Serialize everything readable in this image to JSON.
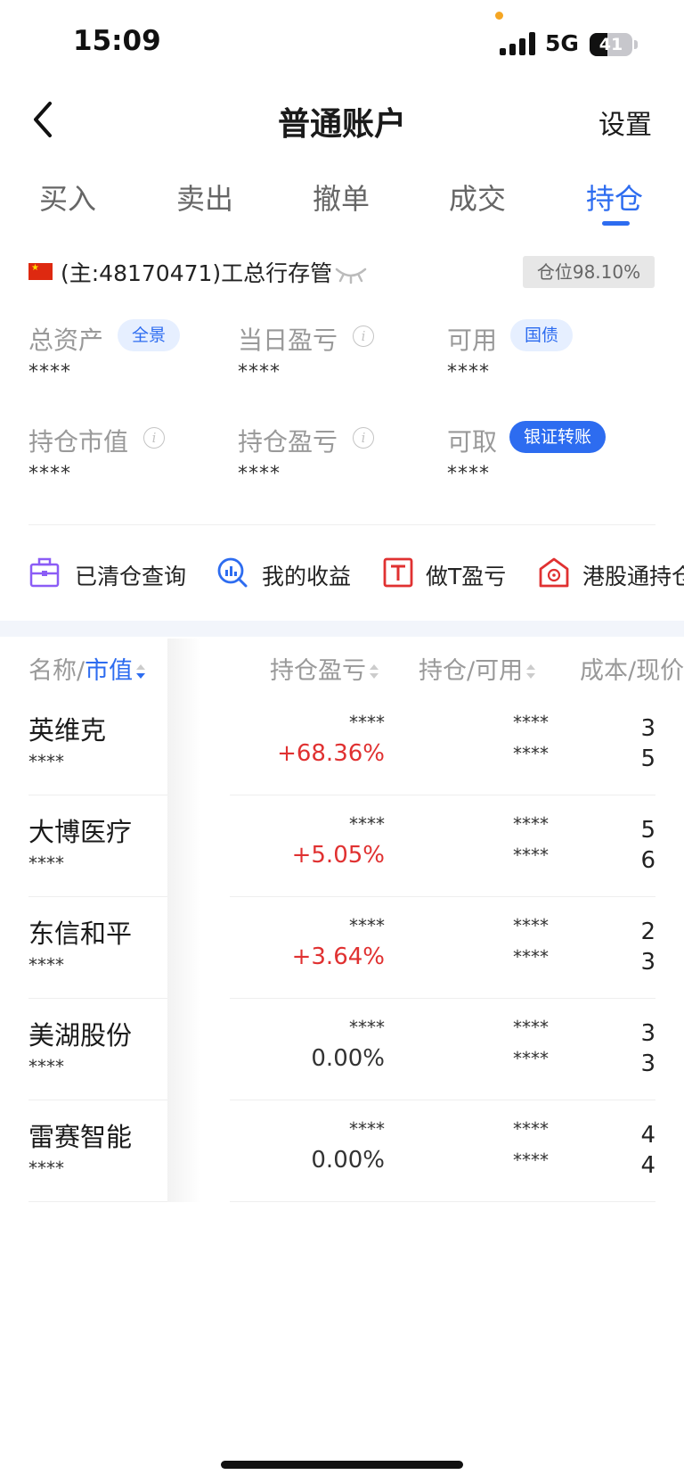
{
  "status_bar": {
    "time": "15:09",
    "network": "5G",
    "battery": "41",
    "battery_level": 0.41
  },
  "header": {
    "title": "普通账户",
    "settings": "设置"
  },
  "tabs": [
    {
      "label": "买入"
    },
    {
      "label": "卖出"
    },
    {
      "label": "撤单"
    },
    {
      "label": "成交"
    },
    {
      "label": "持仓",
      "active": true
    }
  ],
  "account": {
    "name": "(主:48170471)工总行存管",
    "position_ratio": "仓位98.10%"
  },
  "metrics": {
    "total_assets": {
      "label": "总资产",
      "tag": "全景",
      "value": "****"
    },
    "daily_pl": {
      "label": "当日盈亏",
      "value": "****"
    },
    "available": {
      "label": "可用",
      "tag": "国债",
      "value": "****"
    },
    "market_value": {
      "label": "持仓市值",
      "value": "****"
    },
    "holding_pl": {
      "label": "持仓盈亏",
      "value": "****"
    },
    "withdrawable": {
      "label": "可取",
      "tag": "银证转账",
      "value": "****"
    }
  },
  "quick_links": [
    {
      "label": "已清仓查询",
      "icon": "briefcase-icon"
    },
    {
      "label": "我的收益",
      "icon": "chart-search-icon"
    },
    {
      "label": "做T盈亏",
      "icon": "t-icon"
    },
    {
      "label": "港股通持仓",
      "icon": "hk-flower-icon"
    }
  ],
  "table": {
    "headers": {
      "name": "名称/",
      "market_value": "市值",
      "pl": "持仓盈亏",
      "holding": "持仓/可用",
      "cost": "成本/现价"
    },
    "rows": [
      {
        "name": "英维克",
        "value": "****",
        "pl": "****",
        "pl_pct": "+68.36%",
        "trend": "up",
        "holding": "****",
        "available": "****",
        "cost": "3",
        "price": "5"
      },
      {
        "name": "大博医疗",
        "value": "****",
        "pl": "****",
        "pl_pct": "+5.05%",
        "trend": "up",
        "holding": "****",
        "available": "****",
        "cost": "5",
        "price": "6"
      },
      {
        "name": "东信和平",
        "value": "****",
        "pl": "****",
        "pl_pct": "+3.64%",
        "trend": "up",
        "holding": "****",
        "available": "****",
        "cost": "2",
        "price": "3"
      },
      {
        "name": "美湖股份",
        "value": "****",
        "pl": "****",
        "pl_pct": "0.00%",
        "trend": "flat",
        "holding": "****",
        "available": "****",
        "cost": "3",
        "price": "3"
      },
      {
        "name": "雷赛智能",
        "value": "****",
        "pl": "****",
        "pl_pct": "0.00%",
        "trend": "flat",
        "holding": "****",
        "available": "****",
        "cost": "4",
        "price": "4"
      }
    ]
  },
  "colors": {
    "accent": "#2d6cf0",
    "up": "#e03131"
  }
}
